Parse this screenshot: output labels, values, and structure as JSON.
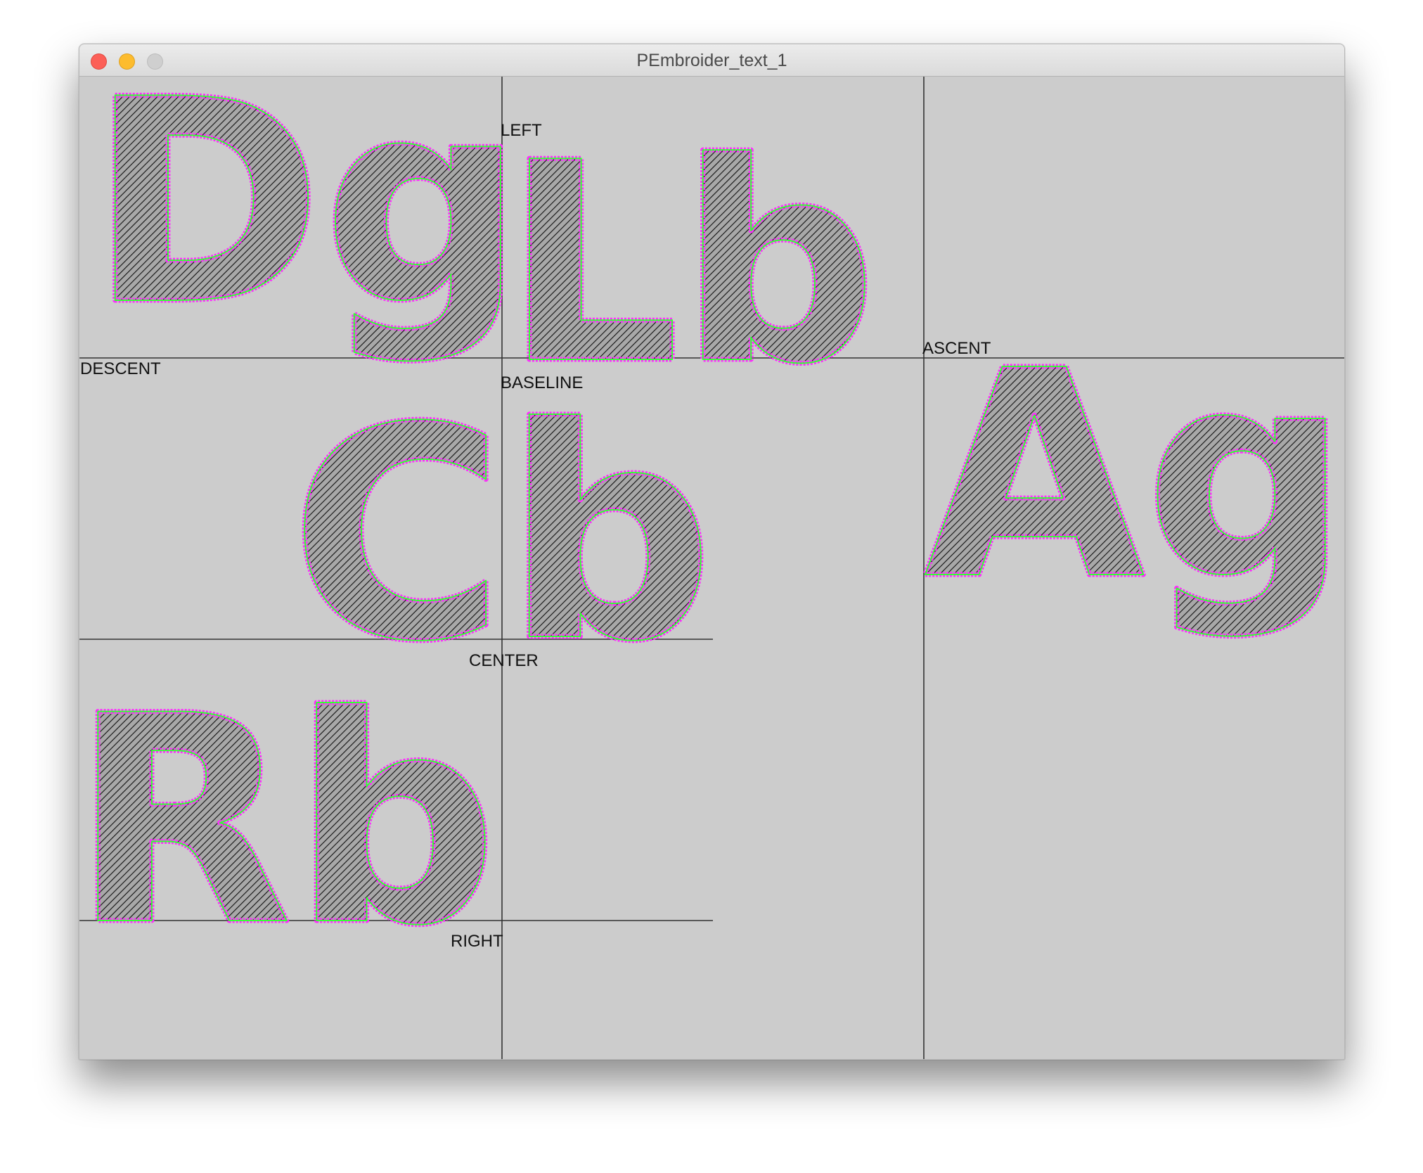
{
  "window": {
    "title": "PEmbroider_text_1",
    "controls": {
      "close_icon": "close-icon",
      "minimize_icon": "minimize-icon",
      "zoom_icon": "zoom-icon"
    }
  },
  "canvas": {
    "background": "#cccccc",
    "guide_line_color": "#333333",
    "stitch_colors": {
      "outline": "#ff2bff",
      "inner_outline": "#33ff33",
      "hatch": "#000000"
    },
    "labels": {
      "left": "LEFT",
      "baseline": "BASELINE",
      "descent": "DESCENT",
      "ascent": "ASCENT",
      "center": "CENTER",
      "right": "RIGHT"
    },
    "samples": {
      "dg": "Dg",
      "lb": "Lb",
      "cb": "Cb",
      "ag": "Ag",
      "rb": "Rb"
    }
  }
}
